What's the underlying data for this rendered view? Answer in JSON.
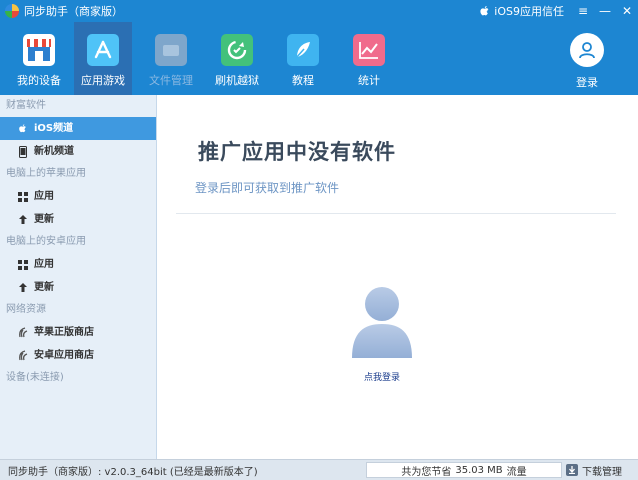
{
  "titlebar": {
    "title": "同步助手（商家版）",
    "trust_label": "iOS9应用信任",
    "buttons": [
      "≡",
      "—",
      "✕"
    ]
  },
  "toolbar": {
    "items": [
      {
        "label": "我的设备",
        "icon": "store-icon",
        "color": "#ffffff",
        "active": false,
        "disabled": false
      },
      {
        "label": "应用游戏",
        "icon": "app-store-icon",
        "color": "#4fc3f7",
        "active": true,
        "disabled": false
      },
      {
        "label": "文件管理",
        "icon": "folder-icon",
        "color": "#8fb0cf",
        "active": false,
        "disabled": true
      },
      {
        "label": "刷机越狱",
        "icon": "refresh-icon",
        "color": "#43c17b",
        "active": false,
        "disabled": false
      },
      {
        "label": "教程",
        "icon": "feather-icon",
        "color": "#3fb4f0",
        "active": false,
        "disabled": false
      },
      {
        "label": "统计",
        "icon": "chart-icon",
        "color": "#f06b8c",
        "active": false,
        "disabled": false
      }
    ],
    "login_label": "登录"
  },
  "sidebar": {
    "sections": [
      {
        "title": "财富软件",
        "items": [
          {
            "label": "iOS频道",
            "icon": "apple-icon",
            "selected": true
          },
          {
            "label": "新机频道",
            "icon": "phone-icon",
            "selected": false
          }
        ]
      },
      {
        "title": "电脑上的苹果应用",
        "items": [
          {
            "label": "应用",
            "icon": "grid-icon",
            "selected": false
          },
          {
            "label": "更新",
            "icon": "upload-icon",
            "selected": false
          }
        ]
      },
      {
        "title": "电脑上的安卓应用",
        "items": [
          {
            "label": "应用",
            "icon": "grid-icon",
            "selected": false
          },
          {
            "label": "更新",
            "icon": "upload-icon",
            "selected": false
          }
        ]
      },
      {
        "title": "网络资源",
        "items": [
          {
            "label": "苹果正版商店",
            "icon": "store-mark-icon",
            "selected": false
          },
          {
            "label": "安卓应用商店",
            "icon": "store-mark-icon",
            "selected": false
          }
        ]
      },
      {
        "title": "设备(未连接)",
        "items": []
      }
    ]
  },
  "main": {
    "title": "推广应用中没有软件",
    "subtitle": "登录后即可获取到推广软件",
    "login_link": "点我登录"
  },
  "statusbar": {
    "version": "同步助手（商家版）: v2.0.3_64bit  (已经是最新版本了)",
    "save_prefix": "共为您节省",
    "save_value": "35.03 MB",
    "save_suffix": "流量",
    "download_label": "下载管理"
  },
  "colors": {
    "header_bg": "#1d86d2",
    "active_tool": "#2b6fb3",
    "sidebar_bg": "#e6eff8",
    "selected_item": "#3f99e0"
  }
}
